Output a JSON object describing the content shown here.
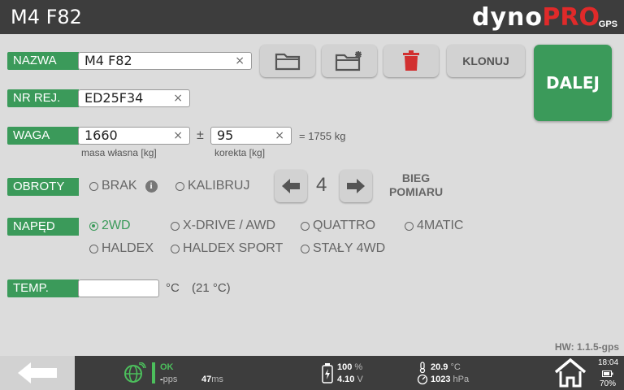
{
  "header": {
    "title": "M4 F82",
    "logo_part1": "dyno",
    "logo_part2": "PRO",
    "logo_suffix": "GPS"
  },
  "form": {
    "nazwa_label": "NAZWA",
    "nazwa_value": "M4 F82",
    "nrrej_label": "NR REJ.",
    "nrrej_value": "ED25F34",
    "waga_label": "WAGA",
    "waga_value": "1660",
    "waga_pm": "±",
    "korekta_value": "95",
    "waga_total": "= 1755 kg",
    "masa_caption": "masa własna [kg]",
    "korekta_caption": "korekta [kg]",
    "obroty_label": "OBROTY",
    "obroty_opt1": "BRAK",
    "obroty_opt2": "KALIBRUJ",
    "bieg_value": "4",
    "bieg_line1": "BIEG",
    "bieg_line2": "POMIARU",
    "naped_label": "NAPĘD",
    "naped_options": [
      "2WD",
      "X-DRIVE / AWD",
      "QUATTRO",
      "4MATIC",
      "HALDEX",
      "HALDEX SPORT",
      "STAŁY 4WD"
    ],
    "naped_selected": "2WD",
    "temp_label": "TEMP.",
    "temp_value": "",
    "temp_unit": "°C",
    "temp_ambient": "(21 °C)",
    "clear_symbol": "×",
    "info_symbol": "i"
  },
  "toolbar": {
    "klonuj_label": "KLONUJ",
    "dalej_label": "DALEJ"
  },
  "hw_version": "HW: 1.1.5-gps",
  "footer": {
    "gps_status": "OK",
    "gps_pps_value": "-",
    "gps_pps_unit": "pps",
    "latency_value": "47",
    "latency_unit": "ms",
    "battery_pct": "100",
    "battery_pct_unit": "%",
    "voltage": "4.10",
    "voltage_unit": "V",
    "temp_value": "20.9",
    "temp_unit": "°C",
    "pressure_value": "1023",
    "pressure_unit": "hPa",
    "clock": "18:04",
    "device_battery": "70%"
  },
  "colors": {
    "accent_green": "#3b9a5a",
    "bar_dark": "#3d3d3d",
    "logo_red": "#e02a2a",
    "delete_red": "#d23030"
  }
}
